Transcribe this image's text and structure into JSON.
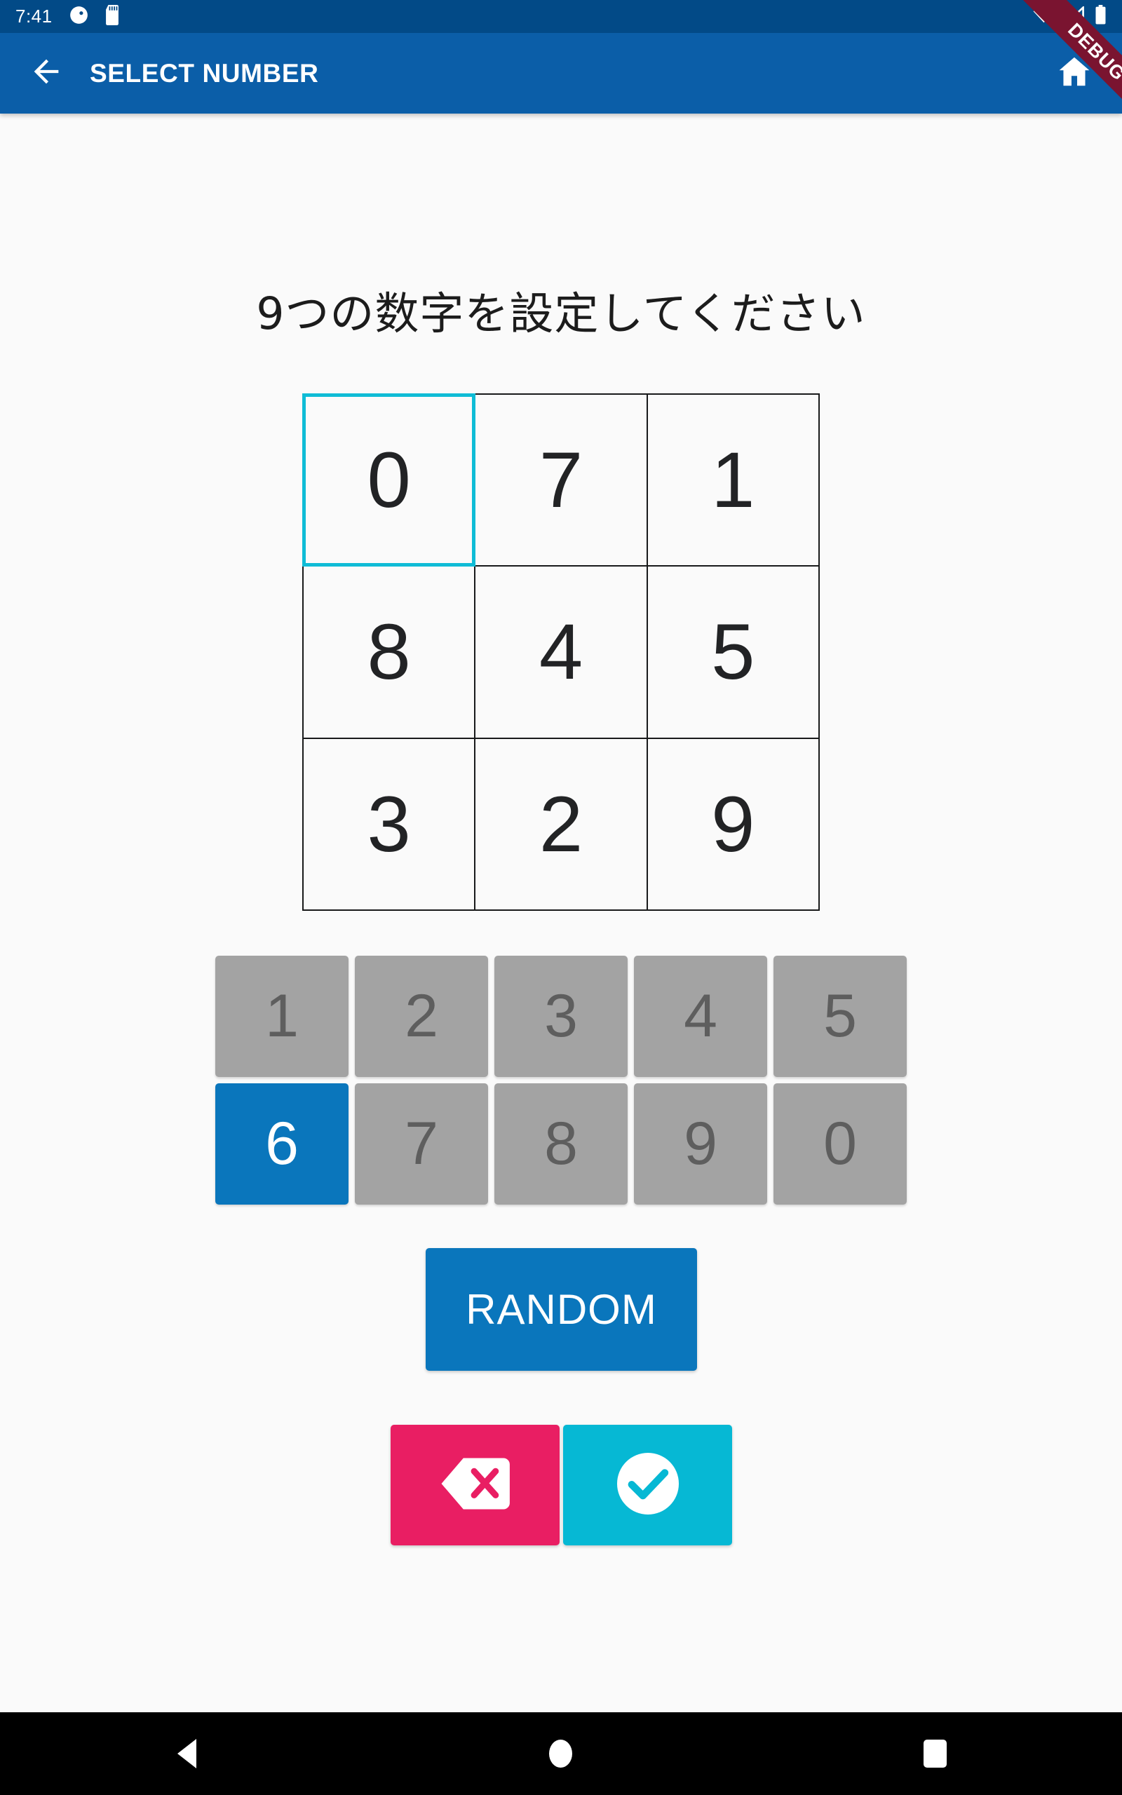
{
  "status_bar": {
    "time": "7:41",
    "left_icons": [
      "headset-icon",
      "sd-card-icon"
    ],
    "right_icons": [
      "wifi-icon",
      "cell-signal-icon",
      "battery-icon"
    ],
    "background": "#024A87"
  },
  "debug_banner": {
    "label": "DEBUG",
    "color": "#7A1430"
  },
  "app_bar": {
    "title": "SELECT NUMBER",
    "back_icon": "arrow-back-icon",
    "home_icon": "home-icon",
    "background": "#0B5EA8"
  },
  "main": {
    "prompt": "9つの数字を設定してください",
    "grid": {
      "rows": [
        [
          "0",
          "7",
          "1"
        ],
        [
          "8",
          "4",
          "5"
        ],
        [
          "3",
          "2",
          "9"
        ]
      ],
      "selected_index": 0,
      "selected_border_color": "#0FBCD6",
      "cell_border_color": "#18191A"
    },
    "keypad": {
      "rows": [
        [
          "1",
          "2",
          "3",
          "4",
          "5"
        ],
        [
          "6",
          "7",
          "8",
          "9",
          "0"
        ]
      ],
      "active_key": "6",
      "inactive_background": "#A3A3A3",
      "inactive_text": "#5E5E5E",
      "active_background": "#0A76BC",
      "active_text": "#FFFFFF"
    },
    "random_button": {
      "label": "RANDOM",
      "background": "#0A76BC",
      "text_color": "#FFFFFF"
    },
    "actions": [
      {
        "name": "delete",
        "icon": "backspace-icon",
        "background": "#E91E63"
      },
      {
        "name": "confirm",
        "icon": "check-circle-icon",
        "background": "#06B8D4"
      }
    ],
    "background": "#FAFAFA"
  },
  "nav_bar": {
    "buttons": [
      "back-triangle-icon",
      "home-circle-icon",
      "recents-square-icon"
    ],
    "background": "#000000"
  }
}
